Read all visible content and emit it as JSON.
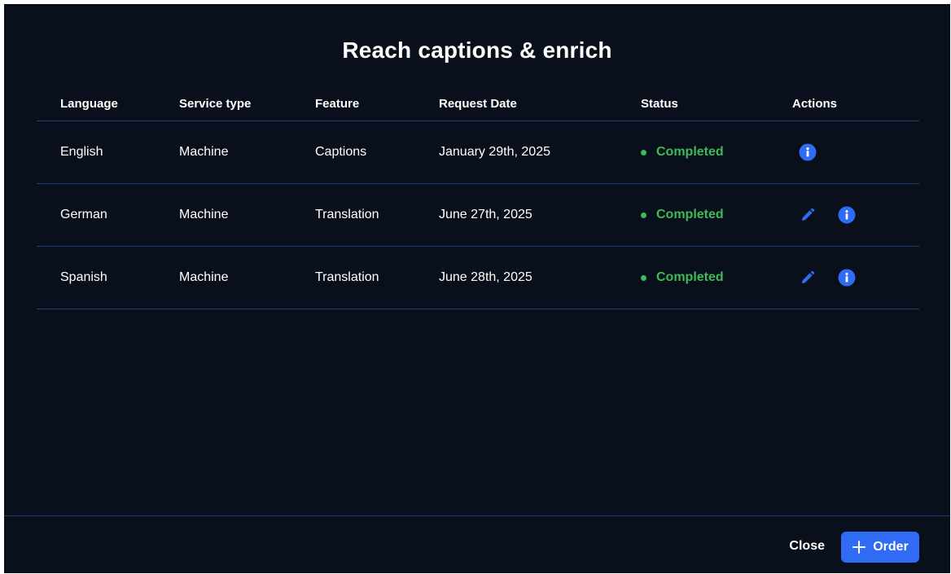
{
  "dialog": {
    "title": "Reach captions & enrich"
  },
  "table": {
    "headers": {
      "language": "Language",
      "service_type": "Service type",
      "feature": "Feature",
      "request_date": "Request Date",
      "status": "Status",
      "actions": "Actions"
    },
    "rows": [
      {
        "language": "English",
        "service_type": "Machine",
        "feature": "Captions",
        "request_date": "January 29th, 2025",
        "status": "Completed",
        "actions": [
          "info-icon"
        ]
      },
      {
        "language": "German",
        "service_type": "Machine",
        "feature": "Translation",
        "request_date": "June 27th, 2025",
        "status": "Completed",
        "actions": [
          "pencil-icon",
          "info-icon"
        ]
      },
      {
        "language": "Spanish",
        "service_type": "Machine",
        "feature": "Translation",
        "request_date": "June 28th, 2025",
        "status": "Completed",
        "actions": [
          "pencil-icon",
          "info-icon"
        ]
      }
    ]
  },
  "footer": {
    "close_label": "Close",
    "order_label": "Order",
    "order_icon": "plus-icon"
  },
  "colors": {
    "background": "#0a101b",
    "accent": "#2f6bf5",
    "status_completed": "#3dbb55",
    "divider": "#1d3f74"
  }
}
